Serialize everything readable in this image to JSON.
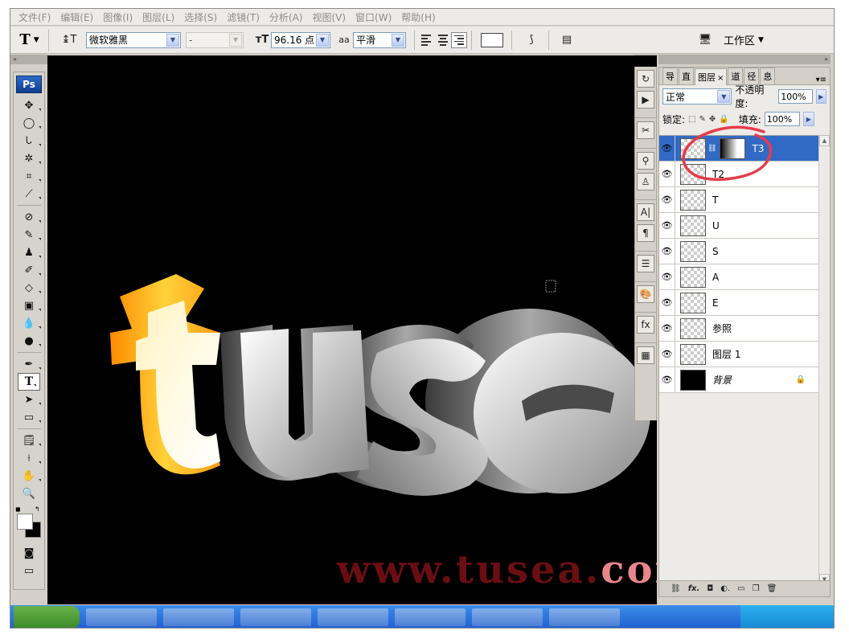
{
  "menu": [
    "文件(F)",
    "编辑(E)",
    "图像(I)",
    "图层(L)",
    "选择(S)",
    "滤镜(T)",
    "分析(A)",
    "视图(V)",
    "窗口(W)",
    "帮助(H)"
  ],
  "options": {
    "tool_glyph": "T",
    "font_family": "微软雅黑",
    "font_style": "-",
    "font_size": "96.16 点",
    "antialias_icon": "aa",
    "antialias": "平滑",
    "workspace": "工作区"
  },
  "toolbox": {
    "logo": "Ps",
    "tools": [
      "move",
      "marquee",
      "lasso",
      "magic-wand",
      "crop",
      "slice",
      "healing",
      "brush",
      "clone",
      "history-brush",
      "eraser",
      "gradient",
      "blur",
      "dodge",
      "pen",
      "type",
      "path-select",
      "shape",
      "notes",
      "eyedropper",
      "hand",
      "zoom"
    ],
    "selected": "type"
  },
  "canvas": {
    "word": "tusea",
    "watermark_dark": "www.tusea.",
    "watermark_pink": "com"
  },
  "layers_panel": {
    "tabs": [
      "导",
      "直",
      "图层",
      "道",
      "径",
      "息"
    ],
    "active_tab": "图层",
    "blend_mode": "正常",
    "opacity_label": "不透明度:",
    "opacity": "100%",
    "lock_label": "锁定:",
    "fill_label": "填充:",
    "fill": "100%",
    "layers": [
      {
        "name": "T3",
        "selected": true,
        "has_mask": true,
        "italic": false,
        "locked": false
      },
      {
        "name": "T2",
        "selected": false,
        "has_mask": false,
        "italic": false,
        "locked": false
      },
      {
        "name": "T",
        "selected": false,
        "has_mask": false,
        "italic": false,
        "locked": false
      },
      {
        "name": "U",
        "selected": false,
        "has_mask": false,
        "italic": false,
        "locked": false
      },
      {
        "name": "S",
        "selected": false,
        "has_mask": false,
        "italic": false,
        "locked": false
      },
      {
        "name": "A",
        "selected": false,
        "has_mask": false,
        "italic": false,
        "locked": false
      },
      {
        "name": "E",
        "selected": false,
        "has_mask": false,
        "italic": false,
        "locked": false
      },
      {
        "name": "参照",
        "selected": false,
        "has_mask": false,
        "italic": false,
        "locked": false
      },
      {
        "name": "图层 1",
        "selected": false,
        "has_mask": false,
        "italic": false,
        "locked": false
      },
      {
        "name": "背景",
        "selected": false,
        "has_mask": false,
        "italic": true,
        "locked": true
      }
    ],
    "footer_icons": [
      "link",
      "fx",
      "mask",
      "adjust",
      "group",
      "new",
      "delete"
    ]
  },
  "colors": {
    "selection": "#316ac5",
    "annotation_circle": "#e63c4a",
    "watermark_dark": "#6b0e13",
    "watermark_pink": "#e8868c"
  }
}
